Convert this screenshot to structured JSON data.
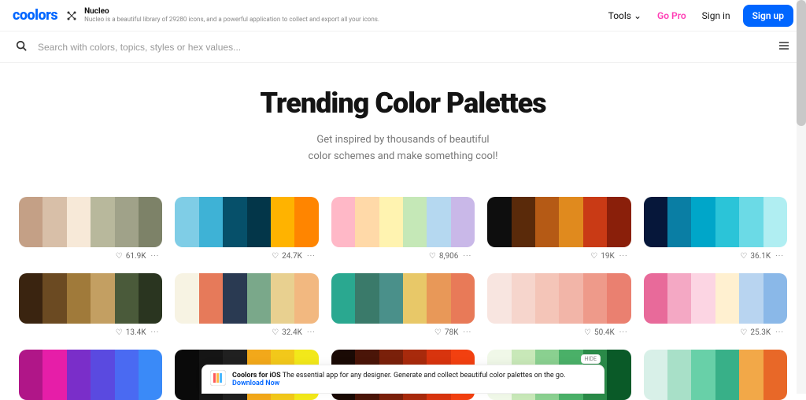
{
  "topbar": {
    "logo": "coolors",
    "promo_title": "Nucleo",
    "promo_text": "Nucleo is a beautiful library of 29280 icons, and a powerful application to collect and export all your icons.",
    "tools": "Tools",
    "gopro": "Go Pro",
    "signin": "Sign in",
    "signup": "Sign up"
  },
  "search": {
    "placeholder": "Search with colors, topics, styles or hex values..."
  },
  "hero": {
    "title": "Trending Color Palettes",
    "sub1": "Get inspired by thousands of beautiful",
    "sub2": "color schemes and make something cool!"
  },
  "palettes": [
    {
      "likes": "61.9K",
      "colors": [
        "#c4a086",
        "#d8bfa8",
        "#f7e9d8",
        "#b8b89c",
        "#a0a289",
        "#7d8268"
      ]
    },
    {
      "likes": "24.7K",
      "colors": [
        "#7fcde6",
        "#3eb2d6",
        "#06506a",
        "#033649",
        "#ffb300",
        "#ff8500"
      ]
    },
    {
      "likes": "8,906",
      "colors": [
        "#ffb8c7",
        "#ffd9a8",
        "#fff3b0",
        "#c5e8b7",
        "#b5d8f0",
        "#c9b8e8"
      ]
    },
    {
      "likes": "19K",
      "colors": [
        "#0e0e0e",
        "#5a2a0a",
        "#b55a15",
        "#e08a1e",
        "#c93a15",
        "#8a1f0a"
      ]
    },
    {
      "likes": "36.1K",
      "colors": [
        "#06173a",
        "#0a7ea4",
        "#00a6c9",
        "#2bc4d8",
        "#6bdae6",
        "#b0eef2"
      ]
    },
    {
      "likes": "13.4K",
      "colors": [
        "#3a2410",
        "#6b4a22",
        "#a07a3a",
        "#c39f62",
        "#4a5a3a",
        "#2a3520"
      ]
    },
    {
      "likes": "32.4K",
      "colors": [
        "#f7f3e3",
        "#e67a5a",
        "#2a3a52",
        "#7aa88a",
        "#e8d090",
        "#f2b880"
      ]
    },
    {
      "likes": "78K",
      "colors": [
        "#2aa890",
        "#3a7a6a",
        "#4a908a",
        "#e8c868",
        "#e89858",
        "#e87a58"
      ]
    },
    {
      "likes": "50.4K",
      "colors": [
        "#f8e5e0",
        "#f6d5cc",
        "#f4c5b8",
        "#f2b5a8",
        "#ee9a8a",
        "#ea8070"
      ]
    },
    {
      "likes": "25.3K",
      "colors": [
        "#e86a9a",
        "#f4a8c4",
        "#fcd5e3",
        "#fff0d0",
        "#b8d4f0",
        "#8ab8e8"
      ]
    },
    {
      "likes": "",
      "colors": [
        "#b01688",
        "#e61ea8",
        "#7a2ec9",
        "#5a4ae0",
        "#4a6af2",
        "#3a8af8"
      ]
    },
    {
      "likes": "",
      "colors": [
        "#0a0a0a",
        "#151515",
        "#202020",
        "#f2a81a",
        "#f2c81a",
        "#f2e81a"
      ]
    },
    {
      "likes": "",
      "colors": [
        "#1a0a05",
        "#4a1508",
        "#7a200a",
        "#a82a0c",
        "#d8340e",
        "#f24010"
      ]
    },
    {
      "likes": "",
      "colors": [
        "#f0f8e8",
        "#c8e8b8",
        "#8ad090",
        "#4ab068",
        "#2a8a48",
        "#0a5a28"
      ]
    },
    {
      "likes": "",
      "colors": [
        "#d8f0e8",
        "#a8e0c8",
        "#68d0a8",
        "#38b088",
        "#f2a848",
        "#e86828"
      ]
    }
  ],
  "bottom": {
    "title": "Coolors for iOS",
    "text": "The essential app for any designer. Generate and collect beautiful color palettes on the go.",
    "dl": "Download Now",
    "hide": "HIDE"
  }
}
